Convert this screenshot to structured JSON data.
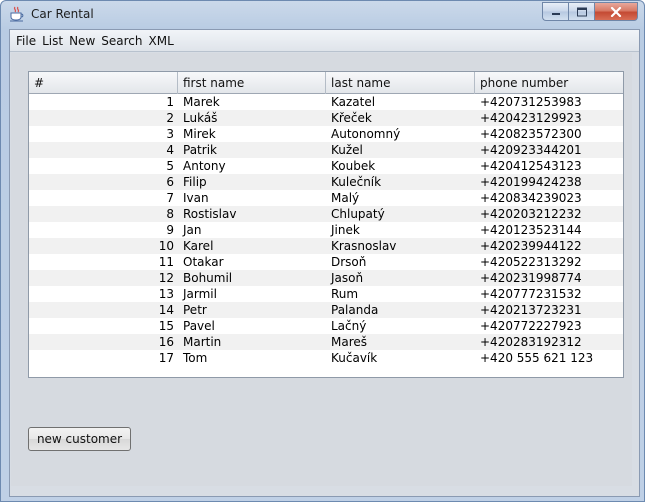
{
  "window": {
    "title": "Car Rental"
  },
  "icons": {
    "app": "java-cup-icon",
    "minimize": "minimize-icon",
    "maximize": "maximize-icon",
    "close": "close-icon"
  },
  "menu": [
    "File",
    "List",
    "New",
    "Search",
    "XML"
  ],
  "table": {
    "columns": [
      "#",
      "first name",
      "last name",
      "phone number"
    ],
    "rows": [
      [
        "1",
        "Marek",
        "Kazatel",
        "+420731253983"
      ],
      [
        "2",
        "Lukáš",
        "Křeček",
        "+420423129923"
      ],
      [
        "3",
        "Mirek",
        "Autonomný",
        "+420823572300"
      ],
      [
        "4",
        "Patrik",
        "Kužel",
        "+420923344201"
      ],
      [
        "5",
        "Antony",
        "Koubek",
        "+420412543123"
      ],
      [
        "6",
        "Filip",
        "Kulečník",
        "+420199424238"
      ],
      [
        "7",
        "Ivan",
        "Malý",
        "+420834239023"
      ],
      [
        "8",
        "Rostislav",
        "Chlupatý",
        "+420203212232"
      ],
      [
        "9",
        "Jan",
        "Jinek",
        "+420123523144"
      ],
      [
        "10",
        "Karel",
        "Krasnoslav",
        "+420239944122"
      ],
      [
        "11",
        "Otakar",
        "Drsoň",
        "+420522313292"
      ],
      [
        "12",
        "Bohumil",
        "Jasoň",
        "+420231998774"
      ],
      [
        "13",
        "Jarmil",
        "Rum",
        "+420777231532"
      ],
      [
        "14",
        "Petr",
        "Palanda",
        "+420213723231"
      ],
      [
        "15",
        "Pavel",
        "Lačný",
        "+420772227923"
      ],
      [
        "16",
        "Martin",
        "Mareš",
        "+420283192312"
      ],
      [
        "17",
        "Tom",
        "Kučavík",
        "+420 555 621 123"
      ]
    ]
  },
  "buttons": {
    "new_customer": "new customer"
  }
}
